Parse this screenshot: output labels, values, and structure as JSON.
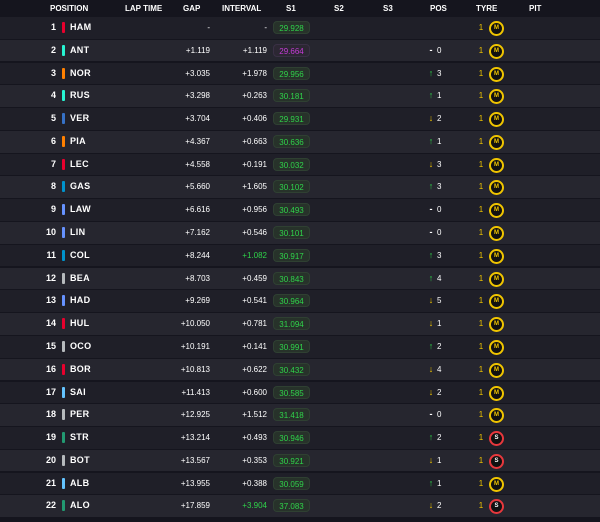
{
  "header": {
    "position": "POSITION",
    "lap_time": "LAP TIME",
    "gap": "GAP",
    "interval": "INTERVAL",
    "s1": "S1",
    "s2": "S2",
    "s3": "S3",
    "pos": "POS",
    "tyre": "TYRE",
    "pit": "PIT"
  },
  "colors": {
    "background": "#15151e",
    "row": "#1f1f28",
    "green": "#2fd34a",
    "purple": "#c53bd7",
    "yellow": "#f0c500",
    "soft_red": "#e8383d"
  },
  "rows": [
    {
      "pos": "1",
      "code": "HAM",
      "team_color": "#e8002d",
      "gap": "-",
      "interval": "-",
      "s1": "29.928",
      "s1_style": "green",
      "pos_dir": "none",
      "pos_arrow": "",
      "pos_change": "",
      "tyre_count": "1",
      "tyre_compound": "M",
      "tyre_style": "medium"
    },
    {
      "pos": "2",
      "code": "ANT",
      "team_color": "#27f4d2",
      "gap": "+1.119",
      "interval": "+1.119",
      "s1": "29.664",
      "s1_style": "purple",
      "pos_dir": "neutral",
      "pos_arrow": "-",
      "pos_change": "0",
      "tyre_count": "1",
      "tyre_compound": "M",
      "tyre_style": "medium"
    },
    {
      "pos": "3",
      "code": "NOR",
      "team_color": "#ff8000",
      "gap": "+3.035",
      "interval": "+1.978",
      "s1": "29.956",
      "s1_style": "green",
      "pos_dir": "up",
      "pos_arrow": "↑",
      "pos_change": "3",
      "tyre_count": "1",
      "tyre_compound": "M",
      "tyre_style": "medium"
    },
    {
      "pos": "4",
      "code": "RUS",
      "team_color": "#27f4d2",
      "gap": "+3.298",
      "interval": "+0.263",
      "s1": "30.181",
      "s1_style": "green",
      "pos_dir": "up",
      "pos_arrow": "↑",
      "pos_change": "1",
      "tyre_count": "1",
      "tyre_compound": "M",
      "tyre_style": "medium"
    },
    {
      "pos": "5",
      "code": "VER",
      "team_color": "#3671c6",
      "gap": "+3.704",
      "interval": "+0.406",
      "s1": "29.931",
      "s1_style": "green",
      "pos_dir": "down",
      "pos_arrow": "↓",
      "pos_change": "2",
      "tyre_count": "1",
      "tyre_compound": "M",
      "tyre_style": "medium"
    },
    {
      "pos": "6",
      "code": "PIA",
      "team_color": "#ff8000",
      "gap": "+4.367",
      "interval": "+0.663",
      "s1": "30.636",
      "s1_style": "green",
      "pos_dir": "up",
      "pos_arrow": "↑",
      "pos_change": "1",
      "tyre_count": "1",
      "tyre_compound": "M",
      "tyre_style": "medium"
    },
    {
      "pos": "7",
      "code": "LEC",
      "team_color": "#e8002d",
      "gap": "+4.558",
      "interval": "+0.191",
      "s1": "30.032",
      "s1_style": "green",
      "pos_dir": "down",
      "pos_arrow": "↓",
      "pos_change": "3",
      "tyre_count": "1",
      "tyre_compound": "M",
      "tyre_style": "medium"
    },
    {
      "pos": "8",
      "code": "GAS",
      "team_color": "#0093cc",
      "gap": "+5.660",
      "interval": "+1.605",
      "s1": "30.102",
      "s1_style": "green",
      "pos_dir": "up",
      "pos_arrow": "↑",
      "pos_change": "3",
      "tyre_count": "1",
      "tyre_compound": "M",
      "tyre_style": "medium"
    },
    {
      "pos": "9",
      "code": "LAW",
      "team_color": "#6692ff",
      "gap": "+6.616",
      "interval": "+0.956",
      "s1": "30.493",
      "s1_style": "green",
      "pos_dir": "neutral",
      "pos_arrow": "-",
      "pos_change": "0",
      "tyre_count": "1",
      "tyre_compound": "M",
      "tyre_style": "medium"
    },
    {
      "pos": "10",
      "code": "LIN",
      "team_color": "#6692ff",
      "gap": "+7.162",
      "interval": "+0.546",
      "s1": "30.101",
      "s1_style": "green",
      "pos_dir": "neutral",
      "pos_arrow": "-",
      "pos_change": "0",
      "tyre_count": "1",
      "tyre_compound": "M",
      "tyre_style": "medium"
    },
    {
      "pos": "11",
      "code": "COL",
      "team_color": "#0093cc",
      "gap": "+8.244",
      "interval": "+1.082",
      "interval_style": "green",
      "s1": "30.917",
      "s1_style": "green",
      "pos_dir": "up",
      "pos_arrow": "↑",
      "pos_change": "3",
      "tyre_count": "1",
      "tyre_compound": "M",
      "tyre_style": "medium"
    },
    {
      "pos": "12",
      "code": "BEA",
      "team_color": "#b6babd",
      "gap": "+8.703",
      "interval": "+0.459",
      "s1": "30.843",
      "s1_style": "green",
      "pos_dir": "up",
      "pos_arrow": "↑",
      "pos_change": "4",
      "tyre_count": "1",
      "tyre_compound": "M",
      "tyre_style": "medium"
    },
    {
      "pos": "13",
      "code": "HAD",
      "team_color": "#6692ff",
      "gap": "+9.269",
      "interval": "+0.541",
      "s1": "30.964",
      "s1_style": "green",
      "pos_dir": "down",
      "pos_arrow": "↓",
      "pos_change": "5",
      "tyre_count": "1",
      "tyre_compound": "M",
      "tyre_style": "medium"
    },
    {
      "pos": "14",
      "code": "HUL",
      "team_color": "#e8002d",
      "gap": "+10.050",
      "interval": "+0.781",
      "s1": "31.094",
      "s1_style": "green",
      "pos_dir": "down",
      "pos_arrow": "↓",
      "pos_change": "1",
      "tyre_count": "1",
      "tyre_compound": "M",
      "tyre_style": "medium"
    },
    {
      "pos": "15",
      "code": "OCO",
      "team_color": "#b6babd",
      "gap": "+10.191",
      "interval": "+0.141",
      "s1": "30.991",
      "s1_style": "green",
      "pos_dir": "up",
      "pos_arrow": "↑",
      "pos_change": "2",
      "tyre_count": "1",
      "tyre_compound": "M",
      "tyre_style": "medium"
    },
    {
      "pos": "16",
      "code": "BOR",
      "team_color": "#e8002d",
      "gap": "+10.813",
      "interval": "+0.622",
      "s1": "30.432",
      "s1_style": "green",
      "pos_dir": "down",
      "pos_arrow": "↓",
      "pos_change": "4",
      "tyre_count": "1",
      "tyre_compound": "M",
      "tyre_style": "medium"
    },
    {
      "pos": "17",
      "code": "SAI",
      "team_color": "#64c4ff",
      "gap": "+11.413",
      "interval": "+0.600",
      "s1": "30.585",
      "s1_style": "green",
      "pos_dir": "down",
      "pos_arrow": "↓",
      "pos_change": "2",
      "tyre_count": "1",
      "tyre_compound": "M",
      "tyre_style": "medium"
    },
    {
      "pos": "18",
      "code": "PER",
      "team_color": "#b6babd",
      "gap": "+12.925",
      "interval": "+1.512",
      "s1": "31.418",
      "s1_style": "green",
      "pos_dir": "neutral",
      "pos_arrow": "-",
      "pos_change": "0",
      "tyre_count": "1",
      "tyre_compound": "M",
      "tyre_style": "medium"
    },
    {
      "pos": "19",
      "code": "STR",
      "team_color": "#229971",
      "gap": "+13.214",
      "interval": "+0.493",
      "s1": "30.946",
      "s1_style": "green",
      "pos_dir": "up",
      "pos_arrow": "↑",
      "pos_change": "2",
      "tyre_count": "1",
      "tyre_compound": "S",
      "tyre_style": "soft"
    },
    {
      "pos": "20",
      "code": "BOT",
      "team_color": "#b6babd",
      "gap": "+13.567",
      "interval": "+0.353",
      "s1": "30.921",
      "s1_style": "green",
      "pos_dir": "down",
      "pos_arrow": "↓",
      "pos_change": "1",
      "tyre_count": "1",
      "tyre_compound": "S",
      "tyre_style": "soft"
    },
    {
      "pos": "21",
      "code": "ALB",
      "team_color": "#64c4ff",
      "gap": "+13.955",
      "interval": "+0.388",
      "s1": "30.059",
      "s1_style": "green",
      "pos_dir": "up",
      "pos_arrow": "↑",
      "pos_change": "1",
      "tyre_count": "1",
      "tyre_compound": "M",
      "tyre_style": "medium"
    },
    {
      "pos": "22",
      "code": "ALO",
      "team_color": "#229971",
      "gap": "+17.859",
      "interval": "+3.904",
      "interval_style": "green",
      "s1": "37.083",
      "s1_style": "green",
      "pos_dir": "down",
      "pos_arrow": "↓",
      "pos_change": "2",
      "tyre_count": "1",
      "tyre_compound": "S",
      "tyre_style": "soft"
    }
  ]
}
